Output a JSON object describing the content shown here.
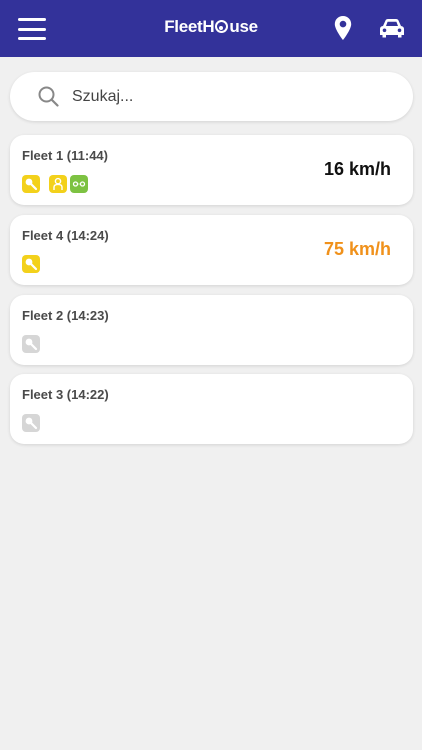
{
  "header": {
    "logo_left": "FleetH",
    "logo_right": "use",
    "menu_icon": "hamburger-menu-icon",
    "map_icon": "map-pin-icon",
    "car_icon": "car-icon"
  },
  "search": {
    "placeholder": "Szukaj..."
  },
  "colors": {
    "header": "#33329a",
    "speed_normal": "#111111",
    "speed_alert": "#f0911b",
    "badge_yellow": "#f3d11b",
    "badge_green": "#7dc242",
    "badge_gray": "#d6d6d6"
  },
  "vehicles": [
    {
      "title": "Fleet 1 (11:44)",
      "speed": "16 km/h",
      "badges": [
        "key-active-icon",
        "person-icon",
        "route-icon"
      ]
    },
    {
      "title": "Fleet 4 (14:24)",
      "speed": "75 km/h",
      "badges": [
        "key-active-icon"
      ]
    },
    {
      "title": "Fleet 2 (14:23)",
      "speed": "",
      "badges": [
        "key-inactive-icon"
      ]
    },
    {
      "title": "Fleet 3 (14:22)",
      "speed": "",
      "badges": [
        "key-inactive-icon"
      ]
    }
  ]
}
